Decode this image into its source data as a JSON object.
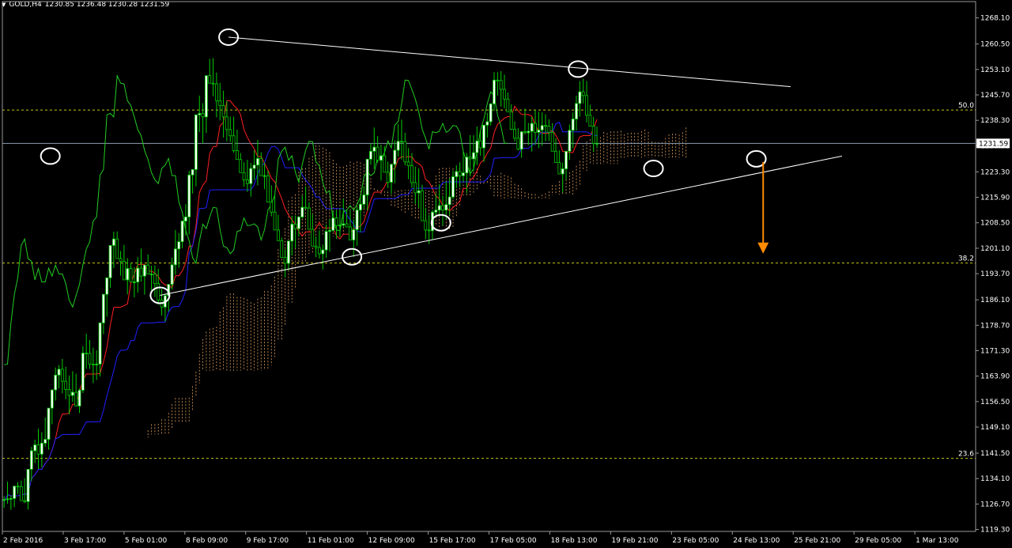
{
  "header": {
    "symbol_label": "GOLD,H4",
    "ohlc": "1230.85 1236.48 1230.28 1231.59",
    "dropdown_icon": "triangle-down-icon"
  },
  "colors": {
    "background": "#000000",
    "candle_up": "#ffffff",
    "candle_down": "#000000",
    "wick": "#00cc00",
    "tenkan": "#ff2020",
    "kijun": "#2020ff",
    "chikou": "#22cc22",
    "cloud": "#e0a060",
    "fib": "#c8c814",
    "trendline": "#ffffff",
    "arrow": "#ff8c00",
    "current_price_line": "#8c9bb0"
  },
  "chart_data": {
    "type": "candlestick",
    "instrument": "GOLD",
    "timeframe": "H4",
    "ylim": [
      1119.2,
      1271.0
    ],
    "y_ticks": [
      "1268.10",
      "1260.50",
      "1253.10",
      "1245.70",
      "1238.30",
      "1230.90",
      "1223.30",
      "1215.90",
      "1208.50",
      "1201.10",
      "1193.70",
      "1186.10",
      "1178.70",
      "1171.30",
      "1163.90",
      "1156.50",
      "1149.10",
      "1141.50",
      "1134.10",
      "1126.70",
      "1119.30"
    ],
    "current_price": "1231.59",
    "x_ticks": [
      "2 Feb 2016",
      "3 Feb 17:00",
      "5 Feb 01:00",
      "8 Feb 09:00",
      "9 Feb 17:00",
      "11 Feb 01:00",
      "12 Feb 09:00",
      "15 Feb 17:00",
      "17 Feb 05:00",
      "18 Feb 13:00",
      "19 Feb 21:00",
      "23 Feb 05:00",
      "24 Feb 13:00",
      "25 Feb 21:00",
      "29 Feb 05:00",
      "1 Mar 13:00"
    ],
    "fib_levels": [
      {
        "label": "50.0",
        "price": 1241.3
      },
      {
        "label": "38.2",
        "price": 1196.8
      },
      {
        "label": "23.6",
        "price": 1140.0
      }
    ],
    "anchor_points": [
      {
        "x_index": 14,
        "price": 1227.9
      },
      {
        "x_index": 46,
        "price": 1187.4
      },
      {
        "x_index": 66,
        "price": 1262.5
      },
      {
        "x_index": 102,
        "price": 1198.6
      },
      {
        "x_index": 128,
        "price": 1208.5
      },
      {
        "x_index": 168,
        "price": 1253.2
      },
      {
        "x_index": 190,
        "price": 1224.3
      },
      {
        "x_index": 220,
        "price": 1227.1
      }
    ],
    "trendlines": [
      {
        "name": "resistance",
        "from": [
          66,
          1262.5
        ],
        "to": [
          230,
          1248.1
        ]
      },
      {
        "name": "support",
        "from": [
          46,
          1187.4
        ],
        "to": [
          245,
          1227.9
        ]
      }
    ],
    "projection_arrow": {
      "x_index": 222,
      "from": 1226.2,
      "to": 1200.0
    },
    "x_span": [
      0,
      284
    ],
    "candles": [
      [
        1127.9,
        1129.0,
        1125.6,
        1128.0
      ],
      [
        1128.0,
        1133.2,
        1126.8,
        1128.2
      ],
      [
        1128.2,
        1129.2,
        1125.0,
        1128.3
      ],
      [
        1128.3,
        1130.7,
        1125.8,
        1131.9
      ],
      [
        1131.9,
        1133.1,
        1129.6,
        1131.8
      ],
      [
        1131.8,
        1133.5,
        1127.8,
        1127.7
      ],
      [
        1127.7,
        1134.2,
        1127.0,
        1127.4
      ],
      [
        1127.4,
        1130.7,
        1125.1,
        1136.8
      ],
      [
        1136.8,
        1143.3,
        1133.4,
        1142.2
      ],
      [
        1142.2,
        1145.4,
        1138.6,
        1143.9
      ],
      [
        1143.9,
        1148.6,
        1136.9,
        1141.2
      ],
      [
        1141.2,
        1147.6,
        1137.4,
        1144.4
      ],
      [
        1144.4,
        1151.9,
        1143.3,
        1145.5
      ],
      [
        1145.5,
        1154.5,
        1142.5,
        1154.6
      ],
      [
        1154.6,
        1159.6,
        1149.9,
        1159.9
      ],
      [
        1159.9,
        1166.4,
        1156.8,
        1164.2
      ],
      [
        1164.2,
        1167.1,
        1160.3,
        1165.9
      ],
      [
        1165.9,
        1168.9,
        1158.9,
        1162.4
      ],
      [
        1162.4,
        1166.6,
        1157.2,
        1160.0
      ],
      [
        1160.0,
        1164.1,
        1152.8,
        1158.3
      ],
      [
        1158.3,
        1165.3,
        1156.4,
        1159.2
      ],
      [
        1159.2,
        1164.6,
        1156.1,
        1155.2
      ],
      [
        1155.2,
        1160.3,
        1153.2,
        1159.8
      ],
      [
        1159.8,
        1172.6,
        1159.0,
        1170.6
      ],
      [
        1170.6,
        1176.2,
        1166.1,
        1170.5
      ],
      [
        1170.5,
        1174.4,
        1166.0,
        1167.4
      ],
      [
        1167.4,
        1172.2,
        1161.9,
        1167.2
      ],
      [
        1167.2,
        1171.4,
        1162.8,
        1167.4
      ],
      [
        1167.4,
        1173.0,
        1163.8,
        1179.4
      ],
      [
        1179.4,
        1182.8,
        1176.1,
        1187.7
      ],
      [
        1187.7,
        1191.2,
        1181.2,
        1192.5
      ],
      [
        1192.5,
        1198.6,
        1189.6,
        1201.9
      ],
      [
        1201.9,
        1205.9,
        1195.3,
        1203.8
      ],
      [
        1203.8,
        1206.0,
        1198.9,
        1198.1
      ],
      [
        1198.1,
        1200.3,
        1193.1,
        1197.3
      ],
      [
        1197.3,
        1202.1,
        1192.6,
        1191.9
      ],
      [
        1191.9,
        1198.2,
        1187.7,
        1195.2
      ],
      [
        1195.2,
        1196.9,
        1192.0,
        1191.3
      ],
      [
        1191.3,
        1195.6,
        1186.8,
        1191.3
      ],
      [
        1191.3,
        1198.5,
        1188.2,
        1195.3
      ],
      [
        1195.3,
        1201.0,
        1191.4,
        1193.0
      ],
      [
        1193.0,
        1196.0,
        1187.6,
        1196.2
      ],
      [
        1196.2,
        1199.3,
        1194.3,
        1193.6
      ],
      [
        1193.6,
        1196.0,
        1188.9,
        1193.6
      ],
      [
        1193.6,
        1196.1,
        1186.9,
        1190.8
      ],
      [
        1190.8,
        1195.1,
        1184.7,
        1186.0
      ],
      [
        1186.0,
        1189.3,
        1181.5,
        1184.0
      ],
      [
        1184.0,
        1188.0,
        1179.8,
        1187.3
      ],
      [
        1187.3,
        1190.2,
        1182.7,
        1190.6
      ],
      [
        1190.6,
        1198.4,
        1189.1,
        1196.3
      ],
      [
        1196.3,
        1206.4,
        1193.4,
        1200.9
      ],
      [
        1200.9,
        1205.5,
        1195.4,
        1203.0
      ],
      [
        1203.0,
        1209.2,
        1201.1,
        1209.0
      ],
      [
        1209.0,
        1213.9,
        1204.8,
        1210.2
      ],
      [
        1210.2,
        1223.6,
        1205.1,
        1222.4
      ],
      [
        1222.4,
        1223.1,
        1217.0,
        1224.0
      ],
      [
        1224.0,
        1232.6,
        1219.1,
        1239.9
      ],
      [
        1239.9,
        1245.5,
        1234.9,
        1240.3
      ],
      [
        1240.3,
        1243.3,
        1231.6,
        1239.3
      ],
      [
        1239.3,
        1246.0,
        1234.6,
        1251.3
      ],
      [
        1251.3,
        1256.2,
        1249.5,
        1249.1
      ],
      [
        1249.1,
        1256.4,
        1245.3,
        1248.9
      ],
      [
        1248.9,
        1252.2,
        1239.2,
        1244.0
      ],
      [
        1244.0,
        1249.2,
        1238.3,
        1242.6
      ],
      [
        1242.6,
        1246.9,
        1233.3,
        1239.3
      ],
      [
        1239.3,
        1244.0,
        1232.2,
        1235.6
      ],
      [
        1235.6,
        1239.4,
        1232.0,
        1233.8
      ],
      [
        1233.8,
        1239.4,
        1228.9,
        1229.5
      ],
      [
        1229.5,
        1235.6,
        1227.1,
        1226.9
      ],
      [
        1226.9,
        1228.8,
        1223.6,
        1223.1
      ],
      [
        1223.1,
        1226.1,
        1219.0,
        1221.0
      ],
      [
        1221.0,
        1226.8,
        1217.5,
        1219.9
      ],
      [
        1219.9,
        1225.9,
        1216.1,
        1224.3
      ],
      [
        1224.3,
        1229.6,
        1220.9,
        1225.3
      ],
      [
        1225.3,
        1232.6,
        1219.4,
        1227.2
      ],
      [
        1227.2,
        1229.0,
        1223.0,
        1222.2
      ],
      [
        1222.2,
        1226.0,
        1218.3,
        1222.2
      ],
      [
        1222.2,
        1223.7,
        1215.1,
        1214.5
      ],
      [
        1214.5,
        1219.4,
        1210.4,
        1211.6
      ],
      [
        1211.6,
        1216.7,
        1208.2,
        1206.4
      ],
      [
        1206.4,
        1210.8,
        1203.3,
        1203.3
      ],
      [
        1203.3,
        1204.2,
        1198.5,
        1198.4
      ],
      [
        1198.4,
        1200.8,
        1192.6,
        1196.7
      ],
      [
        1196.7,
        1202.8,
        1194.6,
        1203.2
      ],
      [
        1203.2,
        1210.5,
        1199.0,
        1208.1
      ],
      [
        1208.1,
        1210.6,
        1201.1,
        1206.8
      ],
      [
        1206.8,
        1210.2,
        1204.5,
        1210.2
      ],
      [
        1210.2,
        1216.5,
        1209.7,
        1213.0
      ],
      [
        1213.0,
        1219.1,
        1212.5,
        1212.8
      ],
      [
        1212.8,
        1214.5,
        1207.5,
        1206.6
      ],
      [
        1206.6,
        1210.9,
        1204.0,
        1201.7
      ],
      [
        1201.7,
        1204.5,
        1198.5,
        1201.3
      ],
      [
        1201.3,
        1206.3,
        1198.1,
        1199.5
      ],
      [
        1199.5,
        1202.2,
        1194.9,
        1200.6
      ],
      [
        1200.6,
        1208.0,
        1198.3,
        1206.0
      ],
      [
        1206.0,
        1209.6,
        1200.1,
        1206.3
      ],
      [
        1206.3,
        1211.9,
        1205.9,
        1209.9
      ],
      [
        1209.9,
        1212.3,
        1203.8,
        1207.7
      ],
      [
        1207.7,
        1212.7,
        1204.3,
        1207.8
      ],
      [
        1207.8,
        1215.5,
        1207.1,
        1208.2
      ],
      [
        1208.2,
        1212.2,
        1207.2,
        1207.3
      ],
      [
        1207.3,
        1212.3,
        1204.3,
        1203.5
      ],
      [
        1203.5,
        1209.5,
        1198.6,
        1206.5
      ],
      [
        1206.5,
        1213.1,
        1201.8,
        1212.2
      ],
      [
        1212.2,
        1216.5,
        1205.8,
        1213.9
      ],
      [
        1213.9,
        1219.1,
        1212.6,
        1216.6
      ],
      [
        1216.6,
        1225.3,
        1212.1,
        1227.0
      ],
      [
        1227.0,
        1231.6,
        1225.4,
        1229.3
      ],
      [
        1229.3,
        1236.2,
        1224.2,
        1230.5
      ],
      [
        1230.5,
        1233.7,
        1225.9,
        1226.7
      ],
      [
        1226.7,
        1231.2,
        1220.8,
        1228.0
      ],
      [
        1228.0,
        1230.8,
        1225.0,
        1223.2
      ],
      [
        1223.2,
        1226.3,
        1218.6,
        1220.3
      ],
      [
        1220.3,
        1225.7,
        1216.9,
        1225.5
      ],
      [
        1225.5,
        1232.5,
        1220.0,
        1229.6
      ],
      [
        1229.6,
        1237.2,
        1227.8,
        1232.2
      ],
      [
        1232.2,
        1238.5,
        1226.9,
        1232.1
      ],
      [
        1232.1,
        1234.7,
        1225.2,
        1226.2
      ],
      [
        1226.2,
        1230.2,
        1221.2,
        1225.1
      ],
      [
        1225.1,
        1228.8,
        1218.7,
        1220.2
      ],
      [
        1220.2,
        1224.8,
        1214.0,
        1217.2
      ],
      [
        1217.2,
        1224.3,
        1212.9,
        1217.8
      ],
      [
        1217.8,
        1219.6,
        1211.1,
        1209.1
      ],
      [
        1209.1,
        1212.9,
        1203.7,
        1206.4
      ],
      [
        1206.4,
        1210.8,
        1202.3,
        1206.2
      ],
      [
        1206.2,
        1212.3,
        1203.5,
        1211.6
      ],
      [
        1211.6,
        1217.1,
        1210.2,
        1212.2
      ],
      [
        1212.2,
        1219.7,
        1210.5,
        1213.5
      ],
      [
        1213.5,
        1216.4,
        1207.7,
        1212.2
      ],
      [
        1212.2,
        1220.5,
        1209.5,
        1213.8
      ],
      [
        1213.8,
        1221.4,
        1210.6,
        1216.0
      ],
      [
        1216.0,
        1223.7,
        1215.4,
        1221.9
      ],
      [
        1221.9,
        1225.2,
        1218.6,
        1223.4
      ],
      [
        1223.4,
        1226.1,
        1218.9,
        1222.2
      ],
      [
        1222.2,
        1229.3,
        1220.4,
        1223.0
      ],
      [
        1223.0,
        1228.8,
        1217.1,
        1227.6
      ],
      [
        1227.6,
        1234.0,
        1222.0,
        1227.1
      ],
      [
        1227.1,
        1234.0,
        1223.5,
        1228.9
      ],
      [
        1228.9,
        1236.5,
        1225.3,
        1232.3
      ],
      [
        1232.3,
        1235.1,
        1228.0,
        1230.3
      ],
      [
        1230.3,
        1233.6,
        1226.2,
        1236.9
      ],
      [
        1236.9,
        1240.5,
        1233.3,
        1237.9
      ],
      [
        1237.9,
        1243.3,
        1236.8,
        1243.1
      ],
      [
        1243.1,
        1252.3,
        1241.0,
        1250.0
      ],
      [
        1250.0,
        1252.3,
        1245.5,
        1249.9
      ],
      [
        1249.9,
        1252.6,
        1242.3,
        1247.3
      ],
      [
        1247.3,
        1251.6,
        1241.8,
        1244.5
      ],
      [
        1244.5,
        1246.4,
        1240.8,
        1240.8
      ],
      [
        1240.8,
        1243.0,
        1235.5,
        1235.7
      ],
      [
        1235.7,
        1238.0,
        1232.2,
        1233.1
      ],
      [
        1233.1,
        1236.0,
        1229.6,
        1229.9
      ],
      [
        1229.9,
        1233.7,
        1227.4,
        1235.0
      ],
      [
        1235.0,
        1241.7,
        1234.2,
        1234.7
      ],
      [
        1234.7,
        1237.5,
        1231.1,
        1235.1
      ],
      [
        1235.1,
        1239.4,
        1229.2,
        1237.4
      ],
      [
        1237.4,
        1241.3,
        1231.1,
        1234.8
      ],
      [
        1234.8,
        1240.8,
        1230.2,
        1235.5
      ],
      [
        1235.5,
        1240.6,
        1230.9,
        1236.8
      ],
      [
        1236.8,
        1240.1,
        1232.2,
        1236.6
      ],
      [
        1236.6,
        1238.6,
        1232.3,
        1234.8
      ],
      [
        1234.8,
        1237.5,
        1229.4,
        1229.3
      ],
      [
        1229.3,
        1233.1,
        1226.6,
        1226.0
      ],
      [
        1226.0,
        1229.6,
        1222.9,
        1222.7
      ],
      [
        1222.7,
        1226.0,
        1217.3,
        1224.2
      ],
      [
        1224.2,
        1229.3,
        1221.1,
        1229.3
      ],
      [
        1229.3,
        1237.1,
        1226.8,
        1235.4
      ],
      [
        1235.4,
        1240.6,
        1230.2,
        1238.7
      ],
      [
        1238.7,
        1245.5,
        1235.3,
        1243.2
      ],
      [
        1243.2,
        1249.7,
        1239.4,
        1246.6
      ],
      [
        1246.6,
        1250.4,
        1243.2,
        1245.5
      ],
      [
        1245.5,
        1249.7,
        1237.7,
        1239.8
      ],
      [
        1239.8,
        1242.8,
        1237.5,
        1236.6
      ],
      [
        1236.6,
        1239.3,
        1229.1,
        1231.6
      ],
      [
        1231.6,
        1236.5,
        1230.3,
        1231.6
      ]
    ]
  }
}
